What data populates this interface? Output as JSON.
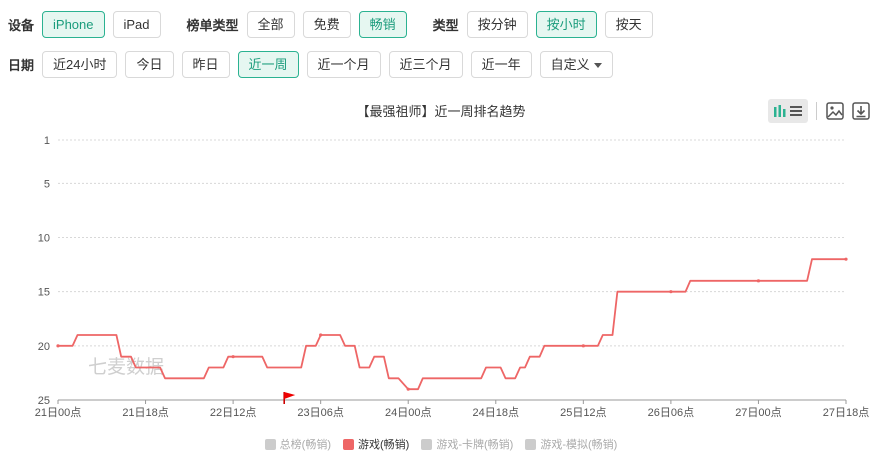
{
  "filters": {
    "device": {
      "label": "设备",
      "options": [
        "iPhone",
        "iPad"
      ],
      "active": 0
    },
    "rank_type": {
      "label": "榜单类型",
      "options": [
        "全部",
        "免费",
        "畅销"
      ],
      "active": 2
    },
    "type": {
      "label": "类型",
      "options": [
        "按分钟",
        "按小时",
        "按天"
      ],
      "active": 1
    },
    "date": {
      "label": "日期",
      "options": [
        "近24小时",
        "今日",
        "昨日",
        "近一周",
        "近一个月",
        "近三个月",
        "近一年"
      ],
      "active": 3,
      "custom_label": "自定义"
    }
  },
  "toolbar_icons": [
    "bar-chart-icon",
    "list-icon",
    "image-download-icon",
    "download-icon"
  ],
  "watermark": "七麦数据",
  "colors": {
    "accent": "#2bb291",
    "series": "#ee6666"
  },
  "chart_data": {
    "type": "line",
    "title": "【最强祖师】近一周排名趋势",
    "y_ticks": [
      1,
      5,
      10,
      15,
      20,
      25
    ],
    "ylim": [
      1,
      25
    ],
    "y_inverted": true,
    "x_ticks": [
      "21日00点",
      "21日18点",
      "22日12点",
      "23日06点",
      "24日00点",
      "24日18点",
      "25日12点",
      "26日06点",
      "27日00点",
      "27日18点"
    ],
    "x_hours_range": [
      0,
      162
    ],
    "grid": true,
    "legend_position": "bottom",
    "legend": [
      {
        "name": "总榜(畅销)",
        "active": false
      },
      {
        "name": "游戏(畅销)",
        "active": true
      },
      {
        "name": "游戏-卡牌(畅销)",
        "active": false
      },
      {
        "name": "游戏-模拟(畅销)",
        "active": false
      }
    ],
    "series": [
      {
        "name": "游戏(畅销)",
        "x_hours": [
          0,
          3,
          4,
          12,
          13,
          15,
          16,
          21,
          22,
          30,
          31,
          34,
          35,
          42,
          43,
          50,
          51,
          53,
          54,
          58,
          59,
          61,
          62,
          64,
          65,
          67,
          68,
          70,
          72,
          74,
          75,
          87,
          88,
          91,
          92,
          94,
          95,
          96,
          97,
          99,
          100,
          102,
          103,
          108,
          109,
          111,
          112,
          114,
          115,
          120,
          121,
          129,
          130,
          140,
          141,
          154,
          155,
          162
        ],
        "ranks": [
          20,
          20,
          19,
          19,
          21,
          21,
          22,
          22,
          23,
          23,
          22,
          22,
          21,
          21,
          22,
          22,
          20,
          20,
          19,
          19,
          20,
          20,
          22,
          22,
          21,
          21,
          23,
          23,
          24,
          24,
          23,
          23,
          22,
          22,
          23,
          23,
          22,
          22,
          21,
          21,
          20,
          20,
          20,
          20,
          20,
          20,
          19,
          19,
          15,
          15,
          15,
          15,
          14,
          14,
          14,
          14,
          12,
          12
        ]
      }
    ],
    "annotations": [
      {
        "type": "flag",
        "x_hours": 50
      }
    ]
  }
}
